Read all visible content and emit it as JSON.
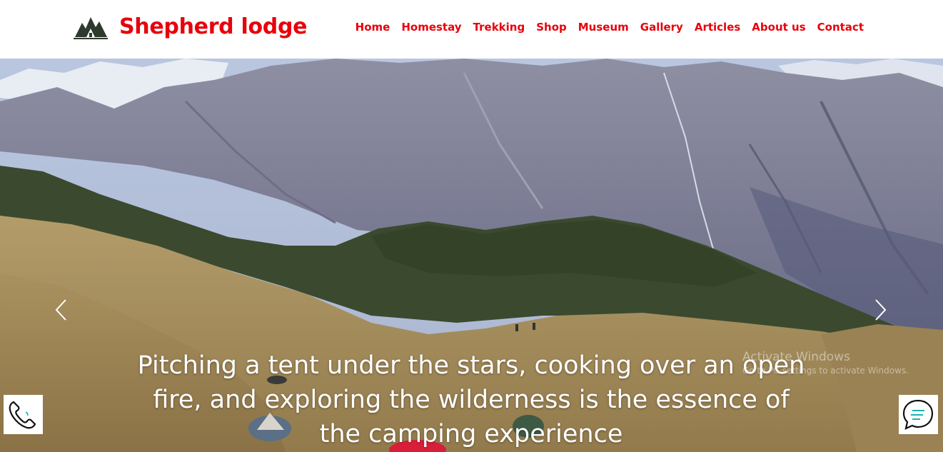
{
  "header": {
    "brand_name": "Shepherd lodge",
    "logo_icon": "mountain-house-logo-icon",
    "nav": [
      "Home",
      "Homestay",
      "Trekking",
      "Shop",
      "Museum",
      "Gallery",
      "Articles",
      "About us",
      "Contact"
    ]
  },
  "hero": {
    "caption": "Pitching a tent under the stars, cooking over an open fire, and exploring the wilderness is the essence of the camping experience",
    "prev_icon": "chevron-left-icon",
    "next_icon": "chevron-right-icon"
  },
  "watermark": {
    "line1": "Activate Windows",
    "line2": "Go to PC settings to activate Windows."
  },
  "widgets": {
    "phone_icon": "phone-icon",
    "chat_icon": "chat-icon"
  },
  "colors": {
    "brand": "#e8000b",
    "caption_text": "#ffffff",
    "chat_accent": "#1bb3b3"
  }
}
